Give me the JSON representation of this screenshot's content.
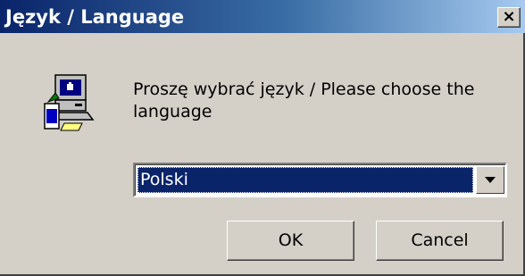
{
  "window": {
    "title": "Język / Language",
    "close_glyph": "×"
  },
  "dialog": {
    "icon": "computer-setup-icon",
    "message": "Proszę wybrać język / Please choose the language"
  },
  "language_select": {
    "selected": "Polski"
  },
  "buttons": {
    "ok_label": "OK",
    "cancel_label": "Cancel"
  },
  "colors": {
    "title_bar_start": "#0a246a",
    "title_bar_end": "#a6caf0",
    "face": "#d4d0c8",
    "selection": "#0a246a"
  }
}
